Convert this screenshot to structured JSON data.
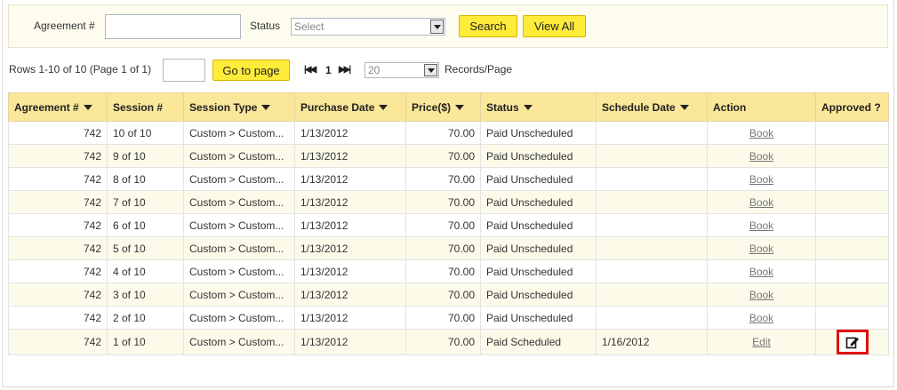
{
  "filters": {
    "agreement_label": "Agreement #",
    "agreement_value": "",
    "status_label": "Status",
    "status_selected": "Select",
    "search_label": "Search",
    "view_all_label": "View All"
  },
  "pager": {
    "rows_info": "Rows 1-10 of 10 (Page 1 of 1)",
    "goto_value": "",
    "goto_label": "Go to page",
    "current_page": "1",
    "records_per_page": "20",
    "records_label": "Records/Page"
  },
  "columns": [
    "Agreement #",
    "Session #",
    "Session Type",
    "Purchase Date",
    "Price($)",
    "Status",
    "Schedule Date",
    "Action",
    "Approved ?"
  ],
  "rows": [
    {
      "agreement": "742",
      "session": "10 of 10",
      "type": "Custom > Custom...",
      "purchase_date": "1/13/2012",
      "price": "70.00",
      "status": "Paid Unscheduled",
      "schedule_date": "",
      "action": "Book"
    },
    {
      "agreement": "742",
      "session": "9 of 10",
      "type": "Custom > Custom...",
      "purchase_date": "1/13/2012",
      "price": "70.00",
      "status": "Paid Unscheduled",
      "schedule_date": "",
      "action": "Book"
    },
    {
      "agreement": "742",
      "session": "8 of 10",
      "type": "Custom > Custom...",
      "purchase_date": "1/13/2012",
      "price": "70.00",
      "status": "Paid Unscheduled",
      "schedule_date": "",
      "action": "Book"
    },
    {
      "agreement": "742",
      "session": "7 of 10",
      "type": "Custom > Custom...",
      "purchase_date": "1/13/2012",
      "price": "70.00",
      "status": "Paid Unscheduled",
      "schedule_date": "",
      "action": "Book"
    },
    {
      "agreement": "742",
      "session": "6 of 10",
      "type": "Custom > Custom...",
      "purchase_date": "1/13/2012",
      "price": "70.00",
      "status": "Paid Unscheduled",
      "schedule_date": "",
      "action": "Book"
    },
    {
      "agreement": "742",
      "session": "5 of 10",
      "type": "Custom > Custom...",
      "purchase_date": "1/13/2012",
      "price": "70.00",
      "status": "Paid Unscheduled",
      "schedule_date": "",
      "action": "Book"
    },
    {
      "agreement": "742",
      "session": "4 of 10",
      "type": "Custom > Custom...",
      "purchase_date": "1/13/2012",
      "price": "70.00",
      "status": "Paid Unscheduled",
      "schedule_date": "",
      "action": "Book"
    },
    {
      "agreement": "742",
      "session": "3 of 10",
      "type": "Custom > Custom...",
      "purchase_date": "1/13/2012",
      "price": "70.00",
      "status": "Paid Unscheduled",
      "schedule_date": "",
      "action": "Book"
    },
    {
      "agreement": "742",
      "session": "2 of 10",
      "type": "Custom > Custom...",
      "purchase_date": "1/13/2012",
      "price": "70.00",
      "status": "Paid Unscheduled",
      "schedule_date": "",
      "action": "Book"
    },
    {
      "agreement": "742",
      "session": "1 of 10",
      "type": "Custom > Custom...",
      "purchase_date": "1/13/2012",
      "price": "70.00",
      "status": "Paid Scheduled",
      "schedule_date": "1/16/2012",
      "action": "Edit"
    }
  ],
  "icons": {
    "first_page": "first-page-icon",
    "last_page": "last-page-icon",
    "approve_edit": "edit-note-icon"
  },
  "colors": {
    "button_yellow": "#ffec3a",
    "header_yellow": "#fbe79a",
    "highlight_red": "#e01010"
  }
}
